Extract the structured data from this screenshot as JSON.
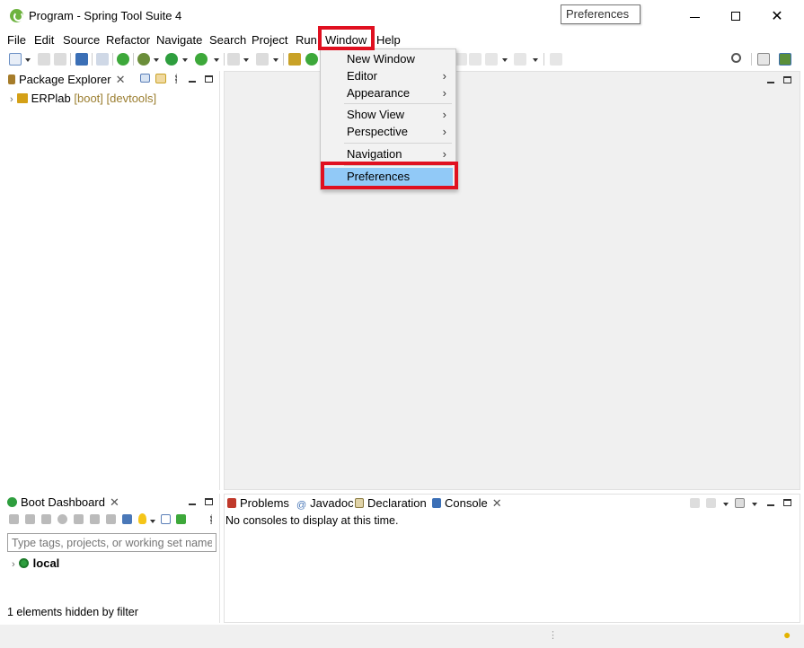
{
  "window": {
    "title": "Program - Spring Tool Suite 4",
    "tooltip": "Preferences",
    "minimize_icon": "minimize-icon",
    "maximize_icon": "maximize-icon",
    "close_glyph": "✕"
  },
  "menubar": {
    "items": [
      {
        "label": "File"
      },
      {
        "label": "Edit"
      },
      {
        "label": "Source"
      },
      {
        "label": "Refactor"
      },
      {
        "label": "Navigate"
      },
      {
        "label": "Search"
      },
      {
        "label": "Project"
      },
      {
        "label": "Run"
      },
      {
        "label": "Window"
      },
      {
        "label": "Help"
      }
    ],
    "active": "Window",
    "highlight_color": "#e01020"
  },
  "window_menu": {
    "items": [
      {
        "label": "New Window",
        "submenu": false
      },
      {
        "label": "Editor",
        "submenu": true
      },
      {
        "label": "Appearance",
        "submenu": true
      },
      {
        "label": "Show View",
        "submenu": true
      },
      {
        "label": "Perspective",
        "submenu": true
      },
      {
        "label": "Navigation",
        "submenu": true
      },
      {
        "label": "Preferences",
        "submenu": false,
        "selected": true
      }
    ],
    "submenu_glyph": "›",
    "selected_color": "#91c9f7"
  },
  "package_explorer": {
    "tab_label": "Package Explorer",
    "close_glyph": "✕",
    "project": {
      "name": "ERPlab",
      "decoration": "[boot] [devtools]"
    }
  },
  "boot_dashboard": {
    "tab_label": "Boot Dashboard",
    "close_glyph": "✕",
    "filter_placeholder": "Type tags, projects, or working set names",
    "local_label": "local",
    "hidden_status": "1 elements hidden by filter"
  },
  "bottom_tabs": {
    "items": [
      {
        "label": "Problems"
      },
      {
        "label": "Javadoc"
      },
      {
        "label": "Declaration"
      },
      {
        "label": "Console",
        "active": true
      }
    ],
    "close_glyph": "✕",
    "console_message": "No consoles to display at this time."
  },
  "colors": {
    "spring_green": "#6db33f",
    "editor_bg": "#f0f0f0",
    "highlight_red": "#e01020"
  }
}
